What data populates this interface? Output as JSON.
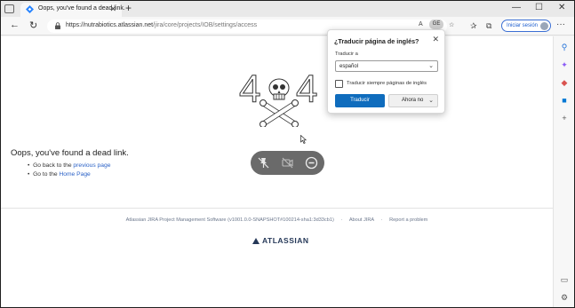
{
  "browser": {
    "tab_title": "Oops, you've found a dead link.",
    "tab_close": "✕",
    "new_tab": "+",
    "url_host": "https://nutrabiotics.atlassian.net",
    "url_path": "/jira/core/projects/IOB/settings/access",
    "translate_badge": "GE",
    "sign_in": "Iniciar sesión",
    "more": "···",
    "min": "—",
    "max": "☐",
    "close": "✕"
  },
  "page": {
    "code_left": "4",
    "code_right": "4",
    "heading": "Oops, you've found a dead link.",
    "link1_prefix": "Go back to the ",
    "link1_text": "previous page",
    "link2_prefix": "Go to the ",
    "link2_text": "Home Page",
    "footer_version": "Atlassian JIRA Project Management Software (v1001.0.0-SNAPSHOT#100214-sha1:3d33cb1)",
    "footer_sep": "·",
    "footer_about": "About JIRA",
    "footer_report": "Report a problem",
    "brand": "ATLASSIAN"
  },
  "translate_popup": {
    "title": "¿Traducir página de inglés?",
    "close": "✕",
    "label": "Traducir a",
    "selected_language": "español",
    "checkbox_label": "Traducir siempre páginas de inglés",
    "translate_button": "Traducir",
    "not_now_button": "Ahora no"
  },
  "colors": {
    "accent": "#0f6cbd",
    "link": "#2b62c7",
    "atlassian_blue": "#253858"
  }
}
